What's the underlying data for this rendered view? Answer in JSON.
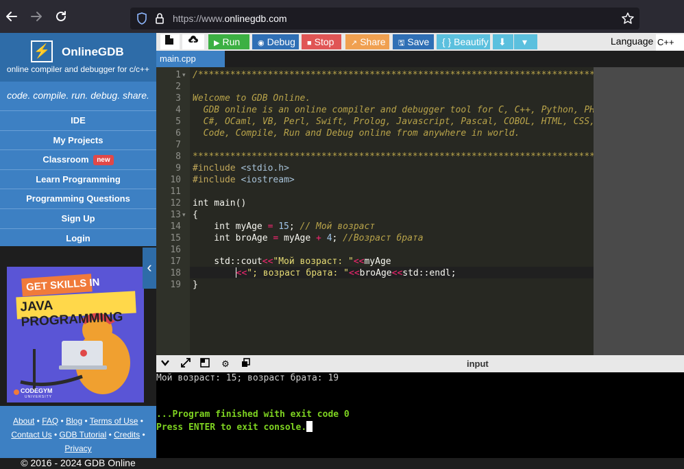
{
  "browser": {
    "url_prefix": "https://www.",
    "url_domain": "onlinegdb.com",
    "back_icon": "back-arrow-icon",
    "forward_icon": "forward-arrow-icon",
    "reload_icon": "reload-icon",
    "bookmark_icon": "star-icon"
  },
  "sidebar": {
    "brand_name": "OnlineGDB",
    "brand_tagline": "online compiler and debugger for c/c++",
    "slogan": "code. compile. run. debug. share.",
    "nav": [
      {
        "label": "IDE"
      },
      {
        "label": "My Projects"
      },
      {
        "label": "Classroom",
        "badge": "new"
      },
      {
        "label": "Learn Programming"
      },
      {
        "label": "Programming Questions"
      },
      {
        "label": "Sign Up"
      },
      {
        "label": "Login"
      }
    ],
    "ad": {
      "line1": "GET SKILLS IN",
      "line2": "JAVA PROGRAMMING",
      "brand": "CODEGYM",
      "brand_sub": "UNIVERSITY"
    },
    "footer_links": [
      "About",
      "FAQ",
      "Blog",
      "Terms of Use",
      "Contact Us",
      "GDB Tutorial",
      "Credits",
      "Privacy"
    ],
    "copyright": "© 2016 - 2024 GDB Online"
  },
  "toolbar": {
    "run": "Run",
    "debug": "Debug",
    "stop": "Stop",
    "share": "Share",
    "save": "Save",
    "beautify": "{ } Beautify",
    "language_label": "Language",
    "language_value": "C++",
    "colors": {
      "run": "#3cb043",
      "debug": "#2f6fb5",
      "stop": "#e05555",
      "share": "#f0a050",
      "save": "#2f6fb5",
      "beautify": "#5bc0de",
      "download": "#5bc0de"
    }
  },
  "editor": {
    "tab": "main.cpp",
    "line_numbers": [
      "1",
      "2",
      "3",
      "4",
      "5",
      "6",
      "7",
      "8",
      "9",
      "10",
      "11",
      "12",
      "13",
      "14",
      "15",
      "16",
      "17",
      "18",
      "19"
    ],
    "lines": {
      "l1": "/******************************************************************************",
      "l3": "Welcome to GDB Online.",
      "l4": "  GDB online is an online compiler and debugger tool for C, C++, Python, PHP, Ruby,",
      "l5": "  C#, OCaml, VB, Perl, Swift, Prolog, Javascript, Pascal, COBOL, HTML, CSS, JS",
      "l6": "  Code, Compile, Run and Debug online from anywhere in world.",
      "l8": "*******************************************************************************/",
      "l9_kw": "#include",
      "l9_hdr": "<stdio.h>",
      "l10_kw": "#include",
      "l10_hdr": "<iostream>",
      "l12": "int main()",
      "l13": "{",
      "l14_a": "    int myAge ",
      "l14_op": "=",
      "l14_num": "15",
      "l14_semi": ";",
      "l14_cm": "// Мой возраст",
      "l15_a": "    int broAge ",
      "l15_op": "=",
      "l15_b": " myAge ",
      "l15_op2": "+",
      "l15_num": "4",
      "l15_semi": ";",
      "l15_cm": "//Возраст брата",
      "l17_a": "    std::cout",
      "l17_op": "<<",
      "l17_str": "\"Мой возраст: \"",
      "l17_op2": "<<",
      "l17_b": "myAge",
      "l18_pre": "        ",
      "l18_op": "<<",
      "l18_str": "\"; возраст брата: \"",
      "l18_op2": "<<",
      "l18_b": "broAge",
      "l18_op3": "<<",
      "l18_c": "std::endl;",
      "l19": "}"
    }
  },
  "console": {
    "input_label": "input",
    "output": "Мой возраст: 15; возраст брата: 19",
    "finished": "...Program finished with exit code 0",
    "press_enter": "Press ENTER to exit console."
  }
}
